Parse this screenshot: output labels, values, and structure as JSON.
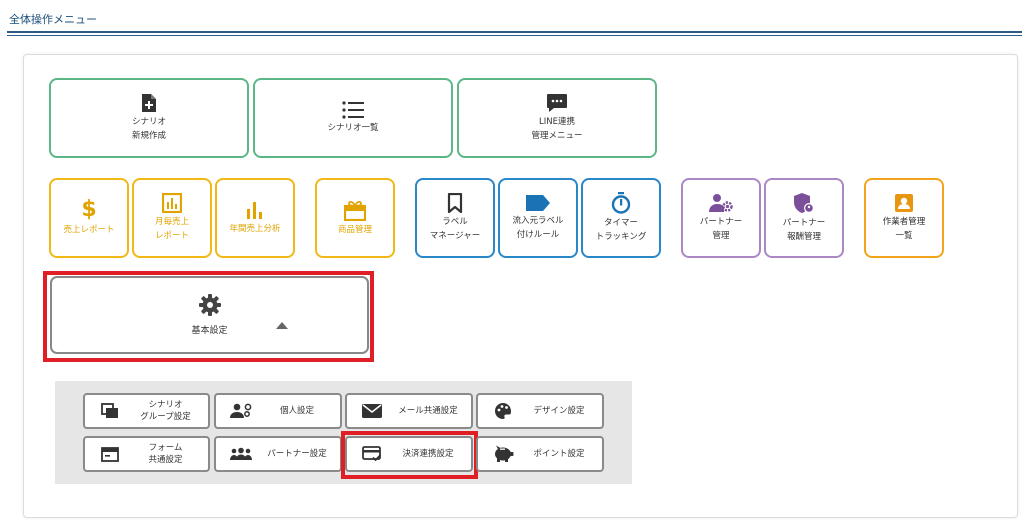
{
  "header": {
    "title": "全体操作メニュー"
  },
  "colors": {
    "green": "#5bb786",
    "yellow": "#f1b816",
    "blue": "#2a87c8",
    "purple": "#ab88c4",
    "orange": "#f2a51c",
    "highlight": "#e01e25"
  },
  "menu_tiles": [
    {
      "l1": "シナリオ",
      "l2": "新規作成",
      "icon": "file-plus-icon",
      "group": "green"
    },
    {
      "l1": "シナリオ一覧",
      "l2": "",
      "icon": "list-icon",
      "group": "green"
    },
    {
      "l1": "LINE連携",
      "l2": "管理メニュー",
      "icon": "chat-icon",
      "group": "green"
    },
    {
      "l1": "売上レポート",
      "l2": "",
      "icon": "dollar-icon",
      "group": "yellow"
    },
    {
      "l1": "月毎売上",
      "l2": "レポート",
      "icon": "bar-chart-box-icon",
      "group": "yellow"
    },
    {
      "l1": "年間売上分析",
      "l2": "",
      "icon": "bar-chart-icon",
      "group": "yellow"
    },
    {
      "l1": "商品管理",
      "l2": "",
      "icon": "gift-icon",
      "group": "yellow"
    },
    {
      "l1": "ラベル",
      "l2": "マネージャー",
      "icon": "bookmark-icon",
      "group": "blue"
    },
    {
      "l1": "流入元ラベル",
      "l2": "付けルール",
      "icon": "tag-icon",
      "group": "blue"
    },
    {
      "l1": "タイマー",
      "l2": "トラッキング",
      "icon": "timer-icon",
      "group": "blue"
    },
    {
      "l1": "パートナー",
      "l2": "管理",
      "icon": "user-gear-icon",
      "group": "purple"
    },
    {
      "l1": "パートナー",
      "l2": "報酬管理",
      "icon": "shield-user-icon",
      "group": "purple"
    },
    {
      "l1": "作業者管理",
      "l2": "一覧",
      "icon": "contact-card-icon",
      "group": "orange"
    }
  ],
  "basic_settings": {
    "label": "基本設定",
    "icon": "gear-icon"
  },
  "settings_buttons": [
    {
      "l1": "シナリオ",
      "l2": "グループ設定",
      "icon": "copy-icon"
    },
    {
      "l1": "個人設定",
      "l2": "",
      "icon": "user-settings-icon"
    },
    {
      "l1": "メール共通設定",
      "l2": "",
      "icon": "envelope-icon"
    },
    {
      "l1": "デザイン設定",
      "l2": "",
      "icon": "palette-icon"
    },
    {
      "l1": "フォーム",
      "l2": "共通設定",
      "icon": "form-window-icon"
    },
    {
      "l1": "パートナー設定",
      "l2": "",
      "icon": "group-icon"
    },
    {
      "l1": "決済連携設定",
      "l2": "",
      "icon": "card-check-icon"
    },
    {
      "l1": "ポイント設定",
      "l2": "",
      "icon": "piggy-bank-icon"
    }
  ]
}
